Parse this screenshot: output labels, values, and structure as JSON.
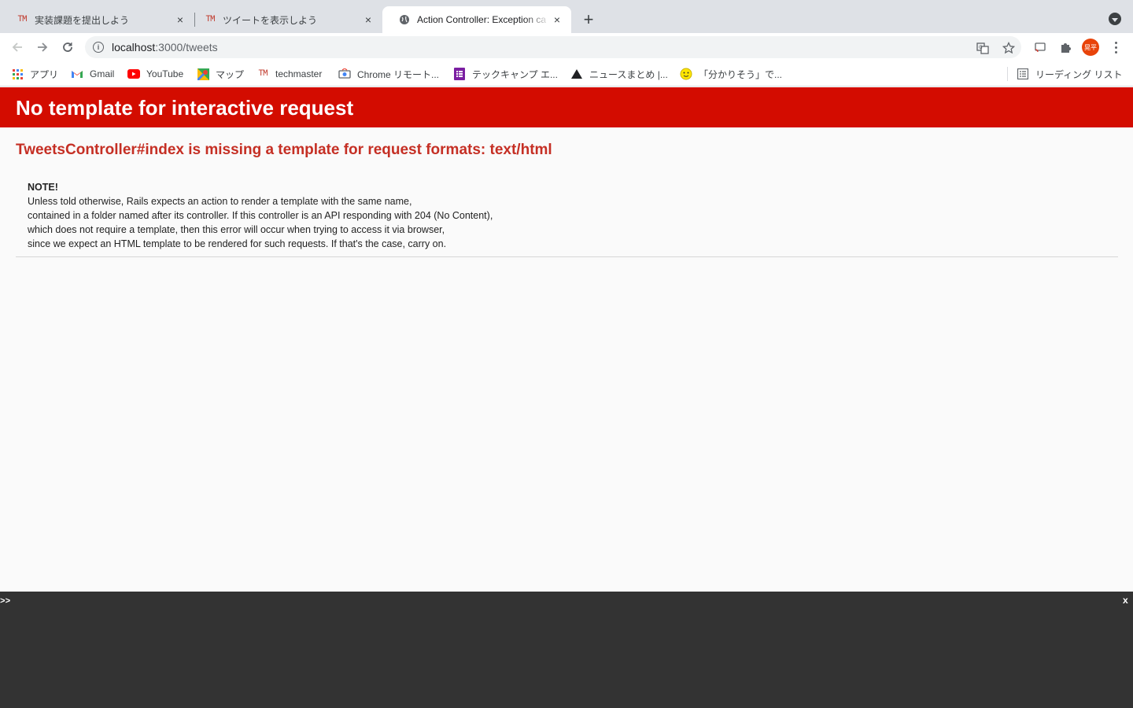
{
  "browser": {
    "tabs": [
      {
        "title": "実装課題を提出しよう",
        "favicon": "TM"
      },
      {
        "title": "ツイートを表示しよう",
        "favicon": "TM"
      },
      {
        "title": "Action Controller: Exception ca",
        "favicon": "globe-icon"
      }
    ],
    "active_tab": 2,
    "new_tab_label": "+",
    "close_label": "×",
    "url_host": "localhost",
    "url_path": ":3000/tweets",
    "avatar_text": "晃平",
    "bookmarks": [
      {
        "label": "アプリ",
        "icon": "apps-grid-icon"
      },
      {
        "label": "Gmail",
        "icon": "gmail-icon"
      },
      {
        "label": "YouTube",
        "icon": "youtube-icon"
      },
      {
        "label": "マップ",
        "icon": "maps-icon"
      },
      {
        "label": "techmaster",
        "icon": "TM"
      },
      {
        "label": "Chrome リモート...",
        "icon": "chrome-remote-icon"
      },
      {
        "label": "テックキャンプ エ...",
        "icon": "forms-icon"
      },
      {
        "label": "ニュースまとめ |...",
        "icon": "triangle-icon"
      },
      {
        "label": "「分かりそう」で...",
        "icon": "smiley-icon"
      }
    ],
    "reading_list_label": "リーディング リスト"
  },
  "page": {
    "header": "No template for interactive request",
    "error_title": "TweetsController#index is missing a template for request formats: text/html",
    "note_heading": "NOTE!",
    "note_lines": [
      "Unless told otherwise, Rails expects an action to render a template with the same name,",
      "contained in a folder named after its controller. If this controller is an API responding with 204 (No Content),",
      "which does not require a template, then this error will occur when trying to access it via browser,",
      "since we expect an HTML template to be rendered for such requests. If that's the case, carry on."
    ]
  },
  "console": {
    "prompt": ">>",
    "close_label": "x"
  },
  "colors": {
    "header_bg": "#d30c00",
    "error_title": "#c52f24",
    "console_bg": "#333333",
    "tab_strip": "#dee1e6"
  }
}
